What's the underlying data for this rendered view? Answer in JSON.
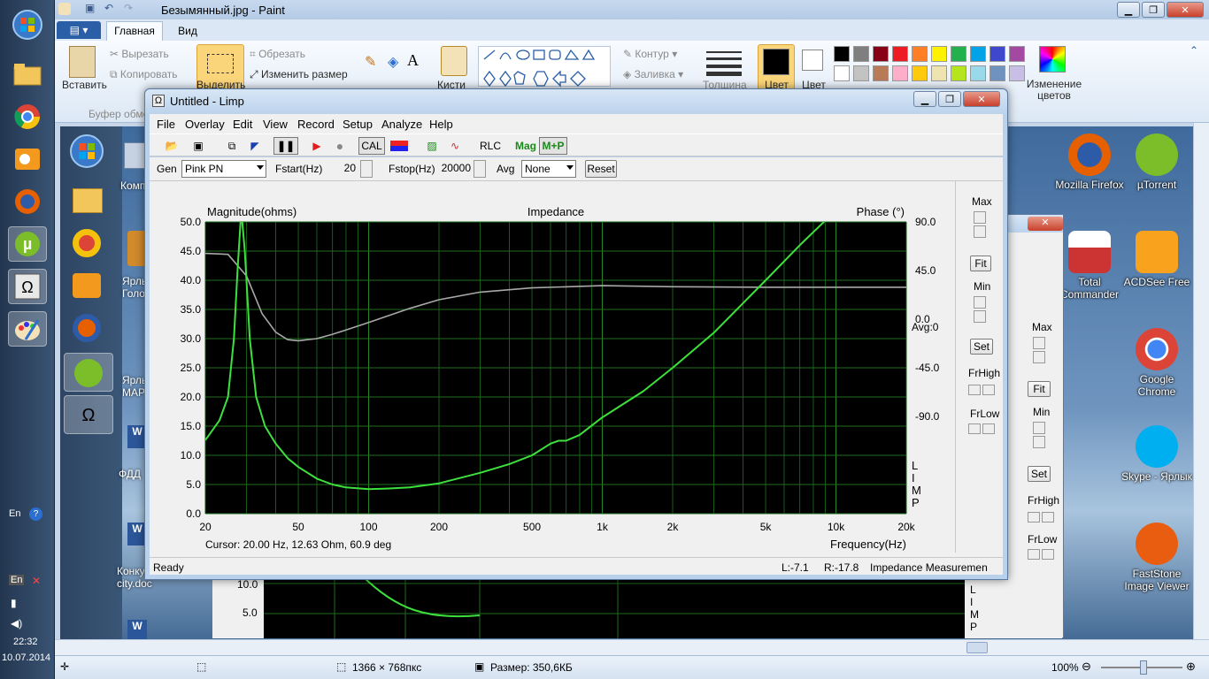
{
  "paint": {
    "title": "Безымянный.jpg - Paint",
    "tabs": [
      "Главная",
      "Вид"
    ],
    "ribbon": {
      "paste": "Вставить",
      "cut": "Вырезать",
      "copy": "Копировать",
      "clipboard_group": "Буфер обме",
      "select": "Выделить",
      "crop": "Обрезать",
      "resize": "Изменить размер",
      "brushes": "Кисти",
      "outline": "Контур",
      "fill": "Заливка",
      "size": "Толщина",
      "color1": "Цвет",
      "color2": "Цвет",
      "edit_colors": "Изменение цветов"
    },
    "palette": [
      "#000000",
      "#7f7f7f",
      "#880015",
      "#ed1c24",
      "#ff7f27",
      "#fff200",
      "#22b14c",
      "#00a2e8",
      "#3f48cc",
      "#a349a4",
      "#ffffff",
      "#c3c3c3",
      "#b97a57",
      "#ffaec9",
      "#ffc90e",
      "#efe4b0",
      "#b5e61d",
      "#99d9ea",
      "#7092be",
      "#c8bfe7"
    ],
    "status": {
      "dimensions": "1366 × 768пкс",
      "size": "Размер: 350,6КБ",
      "zoom": "100%"
    }
  },
  "taskbar": {
    "lang": "En",
    "lang2": "En",
    "time": "22:32",
    "date": "10.07.2014",
    "icons": [
      "windows-start-icon",
      "explorer-icon",
      "chrome-icon",
      "outlook-icon",
      "firefox-icon",
      "utorrent-icon",
      "limp-icon",
      "paint-icon"
    ]
  },
  "desktop": {
    "left_labels": [
      "Комп",
      "Ярлы Голо",
      "Ярлы МАР",
      "ФДД",
      "Конку best city.doc"
    ],
    "right_icons": [
      {
        "label": "Mozilla Firefox"
      },
      {
        "label": "µTorrent"
      },
      {
        "label": "Total Commander"
      },
      {
        "label": "ACDSee Free"
      },
      {
        "label": "Google Chrome"
      },
      {
        "label": "Skype - Ярлык"
      },
      {
        "label": "FastStone Image Viewer"
      }
    ]
  },
  "limp": {
    "title": "Untitled - Limp",
    "menu": [
      "File",
      "Overlay",
      "Edit",
      "View",
      "Record",
      "Setup",
      "Analyze",
      "Help"
    ],
    "toolbar": {
      "cal": "CAL",
      "rlc": "RLC",
      "mag": "Mag",
      "mp": "M+P"
    },
    "gen_label": "Gen",
    "gen_value": "Pink PN",
    "fstart_label": "Fstart(Hz)",
    "fstart_value": "20",
    "fstop_label": "Fstop(Hz)",
    "fstop_value": "20000",
    "avg_label": "Avg",
    "avg_value": "None",
    "reset": "Reset",
    "side": {
      "max": "Max",
      "fit": "Fit",
      "min": "Min",
      "set": "Set",
      "frhigh": "FrHigh",
      "frlow": "FrLow"
    },
    "cursor_text": "Cursor: 20.00 Hz, 12.63 Ohm, 60.9 deg",
    "status_ready": "Ready",
    "status_l": "L:-7.1",
    "status_r": "R:-17.8",
    "status_mode": "Impedance Measuremen",
    "side_letters": [
      "L",
      "I",
      "M",
      "P"
    ],
    "avg_text": "Avg:0"
  },
  "limp2": {
    "side": {
      "max": "Max",
      "fit": "Fit",
      "min": "Min",
      "set": "Set",
      "frhigh": "FrHigh",
      "frlow": "FrLow"
    },
    "ticks": [
      "10.0",
      "5.0"
    ],
    "side_letters": [
      "L",
      "I",
      "M",
      "P"
    ]
  },
  "chart_data": {
    "type": "line",
    "title": "Impedance",
    "ylabel": "Magnitude(ohms)",
    "y2label": "Phase (°)",
    "xlabel": "Frequency(Hz)",
    "xscale": "log",
    "xlim": [
      20,
      20000
    ],
    "ylim": [
      0,
      50
    ],
    "y2lim": [
      -180,
      90
    ],
    "x_ticks": [
      "20",
      "50",
      "100",
      "200",
      "500",
      "1k",
      "2k",
      "5k",
      "10k",
      "20k"
    ],
    "y_ticks": [
      "0.0",
      "5.0",
      "10.0",
      "15.0",
      "20.0",
      "25.0",
      "30.0",
      "35.0",
      "40.0",
      "45.0",
      "50.0"
    ],
    "y2_ticks": [
      "90.0",
      "45.0",
      "0.0",
      "-45.0",
      "-90.0"
    ],
    "grid": true,
    "series": [
      {
        "color": "#3ee03e",
        "x": [
          20,
          23,
          25,
          26.5,
          27.5,
          28.5,
          29.5,
          31,
          33,
          36,
          40,
          45,
          50,
          60,
          70,
          80,
          100,
          120,
          150,
          200,
          300,
          400,
          500,
          600,
          650,
          700,
          800,
          1000,
          1500,
          2000,
          3000,
          5000,
          7000,
          10000
        ],
        "y": [
          12.6,
          16,
          20,
          30,
          42,
          52,
          45,
          30,
          20,
          15,
          12,
          9.5,
          8,
          6,
          5,
          4.5,
          4.2,
          4.3,
          4.5,
          5.2,
          7,
          8.5,
          10,
          12,
          12.5,
          12.5,
          13.5,
          16.5,
          21,
          25,
          31,
          40,
          46,
          52
        ]
      },
      {
        "color": "#a8a8a8",
        "x": [
          20,
          25,
          30,
          35,
          40,
          45,
          50,
          60,
          70,
          80,
          100,
          150,
          200,
          300,
          500,
          1000,
          2000,
          5000,
          10000,
          20000
        ],
        "y": [
          60.9,
          60,
          40,
          5,
          -12,
          -19,
          -20,
          -18,
          -14,
          -10,
          -3,
          10,
          18,
          25,
          29,
          31,
          30,
          29.5,
          29.5,
          29.5
        ]
      }
    ]
  }
}
